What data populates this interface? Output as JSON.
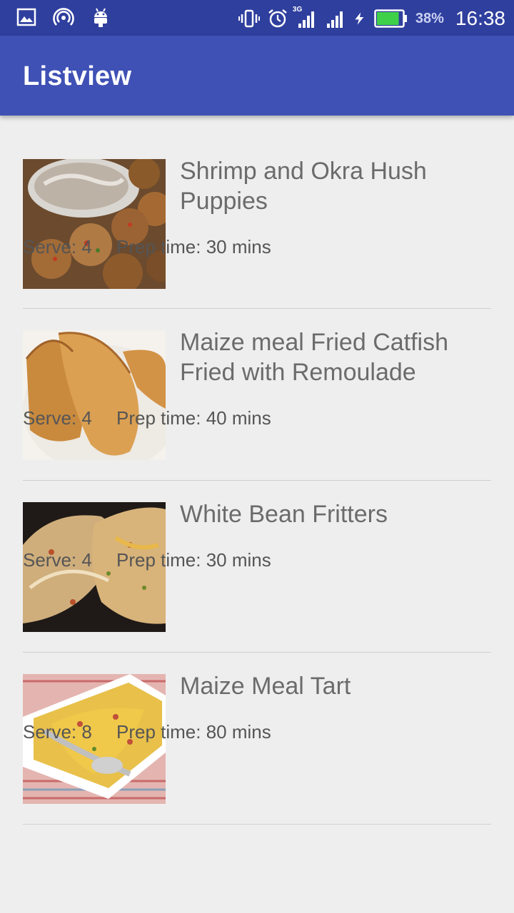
{
  "status_bar": {
    "icons_left": [
      "image-icon",
      "hotspot-icon",
      "android-icon"
    ],
    "icons_right": [
      "vibrate-icon",
      "alarm-icon",
      "signal-3g-icon",
      "signal-icon",
      "charging-icon",
      "battery-icon"
    ],
    "network_label": "3G",
    "battery_percent": "38%",
    "battery_level": 0.38,
    "time": "16:38"
  },
  "app_bar": {
    "title": "Listview",
    "color": "#3f51b5",
    "status_color": "#2f3f9e"
  },
  "recipes": [
    {
      "name": "Shrimp and Okra Hush Puppies",
      "serve": "Serve: 4",
      "prep": "Prep time: 30 mins",
      "image_icon": "hush-puppies-photo"
    },
    {
      "name": "Maize meal Fried Catfish Fried with Remoulade",
      "serve": "Serve: 4",
      "prep": "Prep time: 40 mins",
      "image_icon": "fried-pastry-photo"
    },
    {
      "name": "White Bean Fritters",
      "serve": "Serve: 4",
      "prep": "Prep time: 30 mins",
      "image_icon": "bean-fritters-photo"
    },
    {
      "name": "Maize Meal Tart",
      "serve": "Serve: 8",
      "prep": "Prep time: 80 mins",
      "image_icon": "maize-tart-photo"
    }
  ]
}
